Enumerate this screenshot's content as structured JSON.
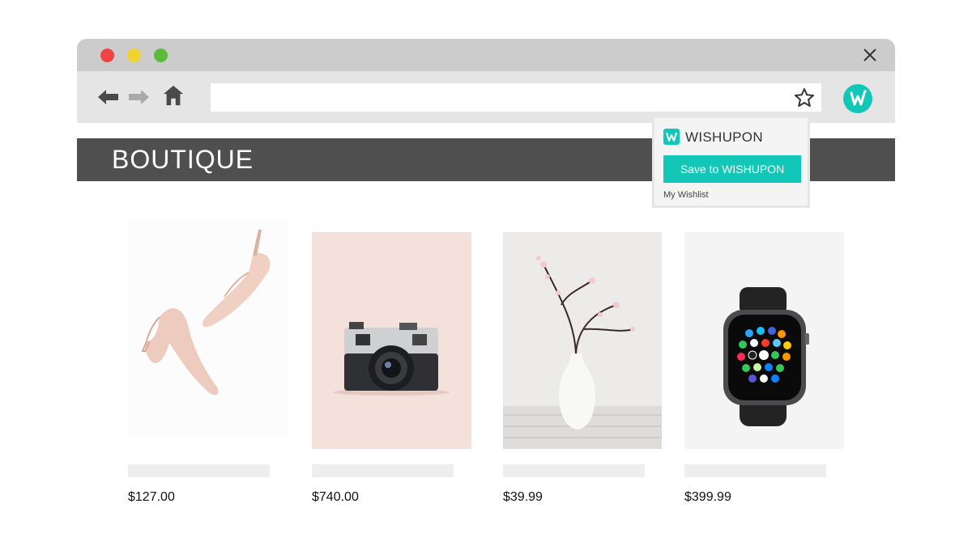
{
  "store": {
    "title": "BOUTIQUE"
  },
  "browser": {
    "window_controls": [
      "close-dot",
      "minimize-dot",
      "maximize-dot"
    ],
    "address_value": "",
    "extension_icon": "wishupon-logo-icon"
  },
  "popup": {
    "brand": "WISHUPON",
    "save_label": "Save to WISHUPON",
    "wishlist_link": "My Wishlist"
  },
  "products": [
    {
      "image": "pink-heels",
      "price": "$127.00"
    },
    {
      "image": "vintage-camera",
      "price": "$740.00"
    },
    {
      "image": "blossom-vase",
      "price": "$39.99"
    },
    {
      "image": "smartwatch",
      "price": "$399.99"
    }
  ],
  "colors": {
    "accent": "#12c7b7",
    "header": "#4f4f4f",
    "titlebar": "#cccccc",
    "toolbar": "#e5e5e5"
  }
}
